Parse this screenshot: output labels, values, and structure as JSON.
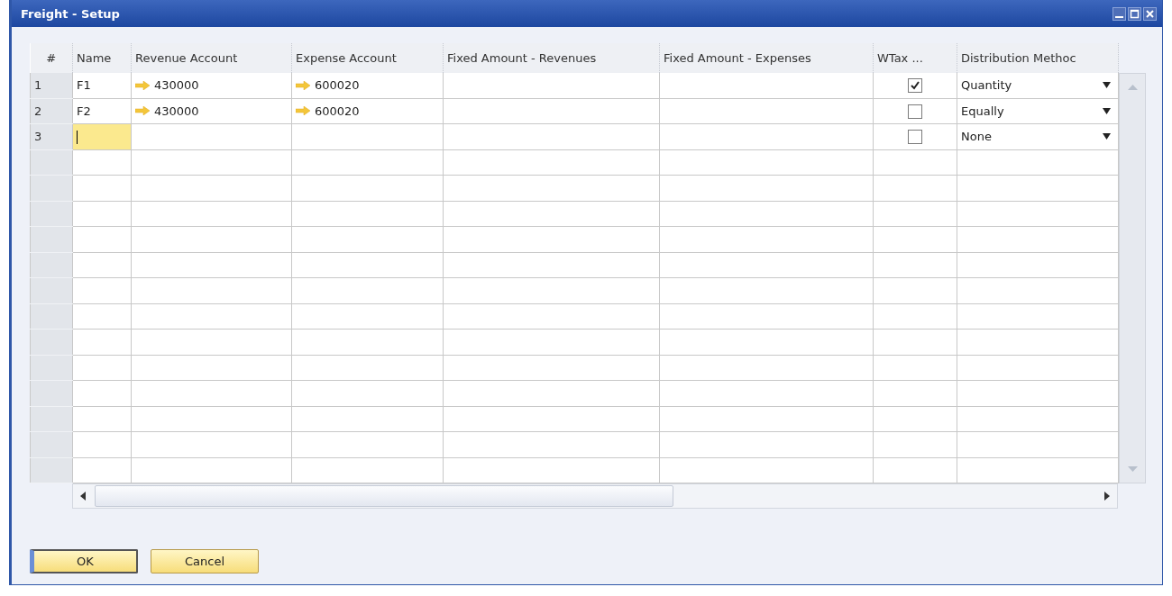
{
  "window": {
    "title": "Freight - Setup"
  },
  "table": {
    "columns": [
      "#",
      "Name",
      "Revenue Account",
      "Expense Account",
      "Fixed Amount - Revenues",
      "Fixed Amount - Expenses",
      "WTax ...",
      "Distribution Methoc"
    ],
    "rows": [
      {
        "number": "1",
        "name": "F1",
        "revenue_account": "430000",
        "expense_account": "600020",
        "wtax": true,
        "distribution": "Quantity",
        "editing": false
      },
      {
        "number": "2",
        "name": "F2",
        "revenue_account": "430000",
        "expense_account": "600020",
        "wtax": false,
        "distribution": "Equally",
        "editing": false
      },
      {
        "number": "3",
        "wtax": false,
        "distribution": "None",
        "editing": true
      }
    ]
  },
  "buttons": [
    {
      "label": "OK",
      "default": true
    },
    {
      "label": "Cancel",
      "default": false
    }
  ]
}
